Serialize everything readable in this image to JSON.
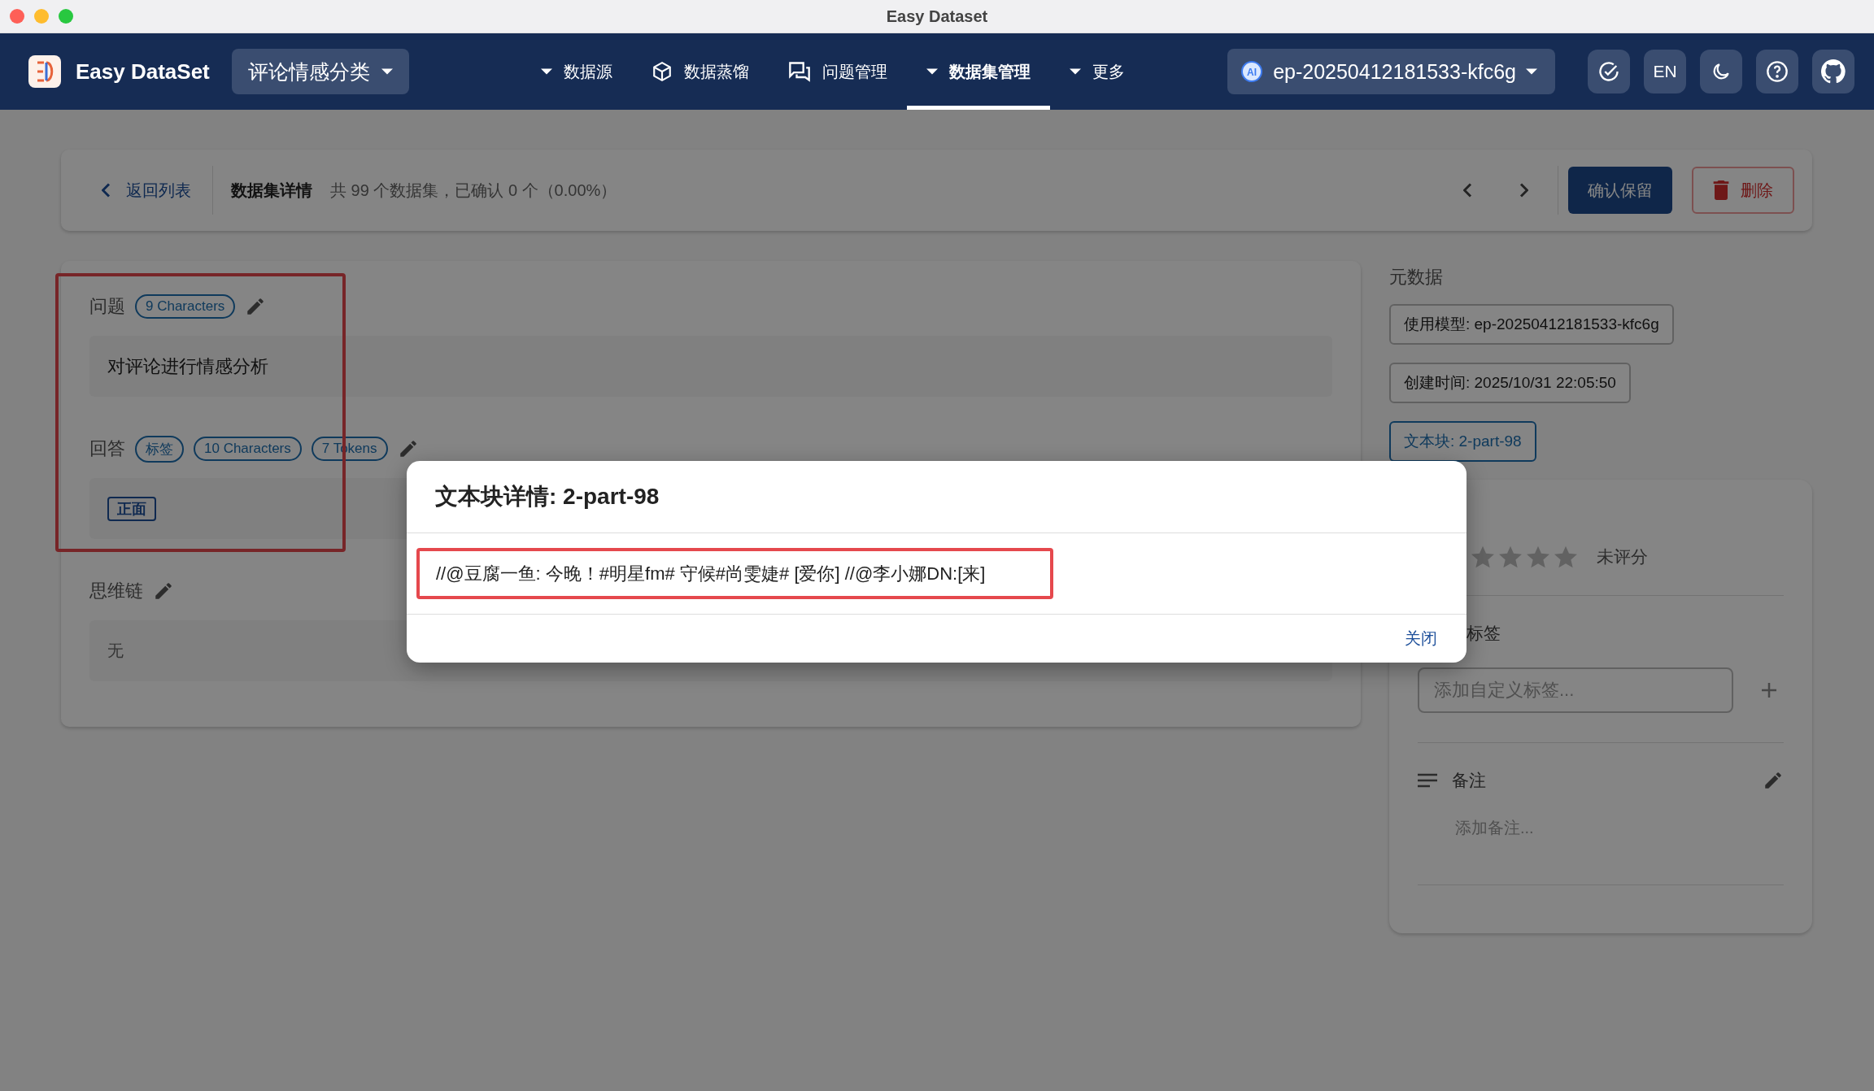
{
  "window": {
    "title": "Easy Dataset"
  },
  "header": {
    "app_name": "Easy DataSet",
    "project": "评论情感分类",
    "nav": [
      {
        "label": "数据源",
        "kind": "dropdown",
        "selected": false
      },
      {
        "label": "数据蒸馏",
        "kind": "cube",
        "selected": false
      },
      {
        "label": "问题管理",
        "kind": "chat",
        "selected": false
      },
      {
        "label": "数据集管理",
        "kind": "dropdown",
        "selected": true
      },
      {
        "label": "更多",
        "kind": "dropdown",
        "selected": false
      }
    ],
    "model_badge": "AI",
    "model": "ep-20250412181533-kfc6g",
    "language": "EN"
  },
  "toolbar": {
    "back": "返回列表",
    "title": "数据集详情",
    "summary": "共 99 个数据集，已确认 0 个（0.00%）",
    "confirm": "确认保留",
    "delete": "删除"
  },
  "detail": {
    "highlighted": true,
    "question": {
      "label": "问题",
      "chips": [
        "9 Characters"
      ],
      "text": "对评论进行情感分析"
    },
    "answer": {
      "label": "回答",
      "chips": [
        "标签",
        "10 Characters",
        "7 Tokens"
      ],
      "tags": [
        "正面"
      ]
    },
    "cot": {
      "label": "思维链",
      "text": "无"
    }
  },
  "metadata": {
    "title": "元数据",
    "chips": [
      {
        "text": "使用模型: ep-20250412181533-kfc6g",
        "kind": "plain"
      },
      {
        "text": "创建时间: 2025/10/31 22:05:50",
        "kind": "plain"
      },
      {
        "text": "文本块: 2-part-98",
        "kind": "link"
      }
    ]
  },
  "review": {
    "stars": 0,
    "rating_text": "未评分",
    "tags_label": "标签",
    "tag_placeholder": "添加自定义标签...",
    "note_label": "备注",
    "note_placeholder": "添加备注..."
  },
  "dialog": {
    "title": "文本块详情: 2-part-98",
    "content": "//@豆腐一鱼: 今晚！#明星fm# 守候#尚雯婕# [爱你] //@李小娜DN:[来]",
    "highlighted": true,
    "close": "关闭"
  }
}
